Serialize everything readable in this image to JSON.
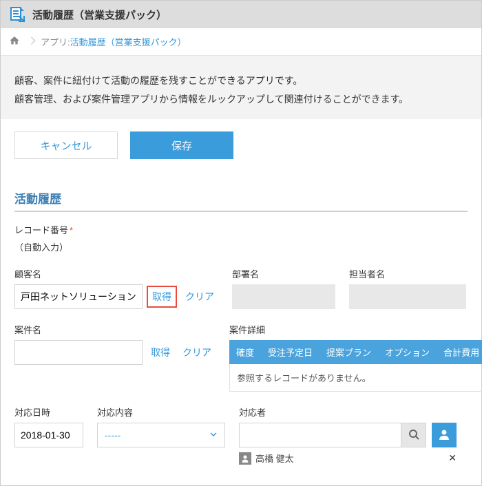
{
  "header": {
    "title": "活動履歴（営業支援パック）"
  },
  "breadcrumb": {
    "app_prefix": "アプリ: ",
    "app_link": "活動履歴（営業支援パック）"
  },
  "description": {
    "line1": "顧客、案件に紐付けて活動の履歴を残すことができるアプリです。",
    "line2": "顧客管理、および案件管理アプリから情報をルックアップして関連付けることができます。"
  },
  "buttons": {
    "cancel": "キャンセル",
    "save": "保存"
  },
  "section": {
    "title": "活動履歴"
  },
  "record_no": {
    "label": "レコード番号",
    "auto": "（自動入力）"
  },
  "customer": {
    "label": "顧客名",
    "value": "戸田ネットソリューションズ",
    "lookup": "取得",
    "clear": "クリア"
  },
  "dept": {
    "label": "部署名"
  },
  "contact": {
    "label": "担当者名"
  },
  "deal": {
    "label": "案件名",
    "value": "",
    "lookup": "取得",
    "clear": "クリア"
  },
  "detail": {
    "label": "案件詳細",
    "cols": {
      "c1": "確度",
      "c2": "受注予定日",
      "c3": "提案プラン",
      "c4": "オプション",
      "c5": "合計費用"
    },
    "empty": "参照するレコードがありません。"
  },
  "respond": {
    "date_label": "対応日時",
    "date_value": "2018-01-30",
    "content_label": "対応内容",
    "content_value": "-----",
    "person_label": "対応者",
    "person_input": "",
    "chip_name": "高橋 健太"
  }
}
